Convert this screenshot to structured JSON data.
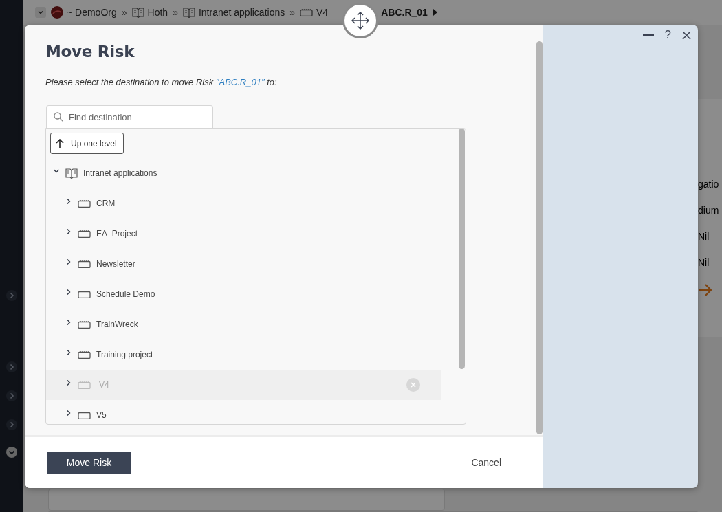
{
  "breadcrumb": [
    {
      "kind": "org",
      "label": "~ DemoOrg"
    },
    {
      "kind": "separator",
      "label": "»"
    },
    {
      "kind": "book",
      "label": "Hoth"
    },
    {
      "kind": "separator",
      "label": "»"
    },
    {
      "kind": "book",
      "label": "Intranet applications"
    },
    {
      "kind": "separator",
      "label": "»"
    },
    {
      "kind": "box",
      "label": "V4"
    },
    {
      "kind": "current",
      "label": "ABC.R_01"
    }
  ],
  "background_texts": [
    "gatio",
    "dium",
    "Nil",
    "Nil"
  ],
  "dialog": {
    "title": "Move Risk",
    "instruction": {
      "before": "Please select the destination to move Risk ",
      "link": "\"ABC.R_01\"",
      "after": " to:"
    },
    "help": "?",
    "search": {
      "placeholder": "Find destination"
    },
    "up_button": "Up one level",
    "tree": [
      {
        "label": "Intranet applications",
        "kind": "book",
        "expanded": true,
        "disabled": false,
        "children": [
          {
            "label": "CRM",
            "kind": "box",
            "expanded": false,
            "disabled": false
          },
          {
            "label": "EA_Project",
            "kind": "box",
            "expanded": false,
            "disabled": false
          },
          {
            "label": "Newsletter",
            "kind": "box",
            "expanded": false,
            "disabled": false
          },
          {
            "label": "Schedule Demo",
            "kind": "box",
            "expanded": false,
            "disabled": false
          },
          {
            "label": "TrainWreck",
            "kind": "box",
            "expanded": false,
            "disabled": false
          },
          {
            "label": "Training project",
            "kind": "box",
            "expanded": false,
            "disabled": false
          },
          {
            "label": "V4",
            "kind": "box",
            "expanded": false,
            "disabled": true
          },
          {
            "label": "V5",
            "kind": "box",
            "expanded": false,
            "disabled": false
          }
        ]
      }
    ],
    "primary_button": "Move Risk",
    "cancel": "Cancel"
  }
}
